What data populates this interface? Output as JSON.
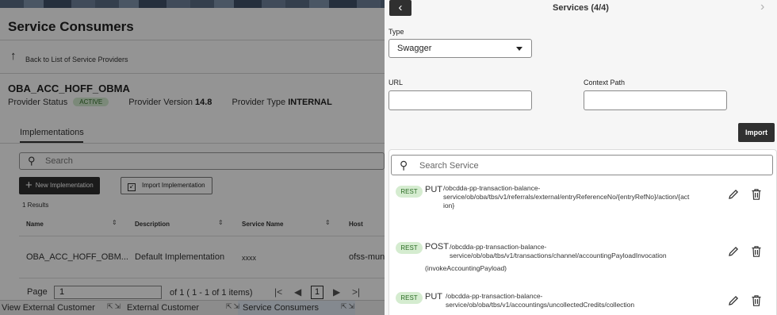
{
  "background_page": {
    "title": "Service Consumers",
    "back_link": "Back to List of Service Providers",
    "provider_name": "OBA_ACC_HOFF_OBMA",
    "provider_status_label": "Provider Status",
    "provider_status_value": "ACTIVE",
    "provider_version_label": "Provider Version",
    "provider_version_value": "14.8",
    "provider_type_label": "Provider Type",
    "provider_type_value": "INTERNAL",
    "tab": "Implementations",
    "search_placeholder": "Search",
    "new_button": "New Implementation",
    "import_button": "Import Implementation",
    "results": "1 Results",
    "columns": [
      "Name",
      "Description",
      "Service Name",
      "Host"
    ],
    "row": [
      "OBA_ACC_HOFF_OBM...",
      "Default Implementation",
      "xxxx",
      "ofss-mun"
    ],
    "pager": {
      "label": "Page",
      "value": "1",
      "of": "of 1   ( 1 - 1 of 1 items)",
      "current": "1"
    },
    "taskbar": [
      "View External Customer",
      "External Customer",
      "Service Consumers"
    ]
  },
  "panel": {
    "title": "Services (4/4)",
    "type_label": "Type",
    "type_value": "Swagger",
    "url_label": "URL",
    "url_value": "",
    "context_label": "Context Path",
    "context_value": "",
    "import_button": "Import",
    "search_placeholder": "Search Service",
    "services": [
      {
        "badge": "REST",
        "method": "PUT",
        "path_line1": "/obcdda-pp-transaction-balance-",
        "path_line2": "service/ob/oba/tbs/v1/referrals/external/entryReferenceNo/{entryRefNo}/action/{act",
        "path_line3": "ion}",
        "operation": ""
      },
      {
        "badge": "REST",
        "method": "POST",
        "path_line1": "/obcdda-pp-transaction-balance-",
        "path_line2": "service/ob/oba/tbs/v1/transactions/channel/accountingPayloadInvocation",
        "path_line3": "",
        "operation": "(invokeAccountingPayload)"
      },
      {
        "badge": "REST",
        "method": "PUT",
        "path_line1": "/obcdda-pp-transaction-balance-",
        "path_line2": "service/ob/oba/tbs/v1/accountings/uncollectedCredits/collection",
        "path_line3": "",
        "operation": ""
      }
    ]
  }
}
